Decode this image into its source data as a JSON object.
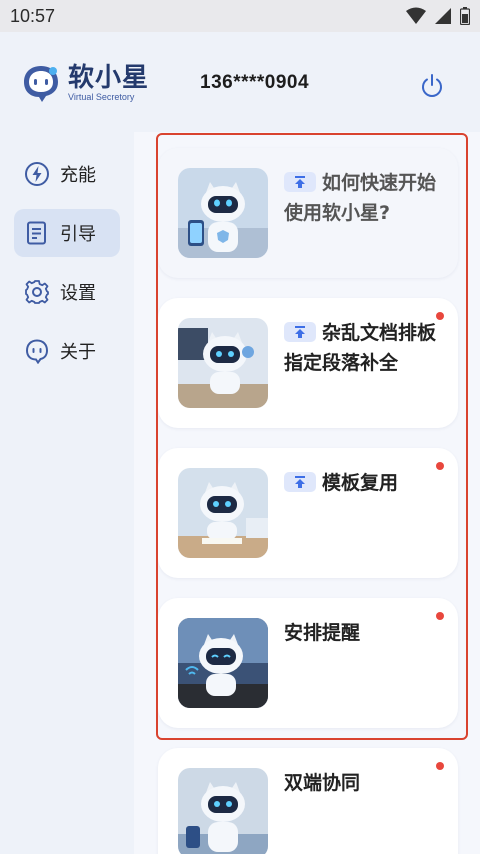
{
  "status_bar": {
    "time": "10:57"
  },
  "header": {
    "brand_name": "软小星",
    "brand_subtitle": "Virtual Secretory",
    "phone": "136****0904"
  },
  "sidebar": {
    "items": [
      {
        "label": "充能",
        "icon": "lightning-icon"
      },
      {
        "label": "引导",
        "icon": "document-icon",
        "active": true
      },
      {
        "label": "设置",
        "icon": "gear-icon"
      },
      {
        "label": "关于",
        "icon": "chat-bubble-icon"
      }
    ]
  },
  "cards": [
    {
      "title": "如何快速开始使用软小星?",
      "pinned": true,
      "unread": false
    },
    {
      "title": "杂乱文档排板指定段落补全",
      "pinned": true,
      "unread": true
    },
    {
      "title": "模板复用",
      "pinned": true,
      "unread": true
    },
    {
      "title": "安排提醒",
      "pinned": false,
      "unread": true
    },
    {
      "title": "双端协同",
      "pinned": false,
      "unread": true
    }
  ],
  "colors": {
    "accent": "#3f5ca3",
    "active_bg": "#d8e2f3",
    "unread_dot": "#e8473d",
    "highlight_border": "#d9432f"
  }
}
